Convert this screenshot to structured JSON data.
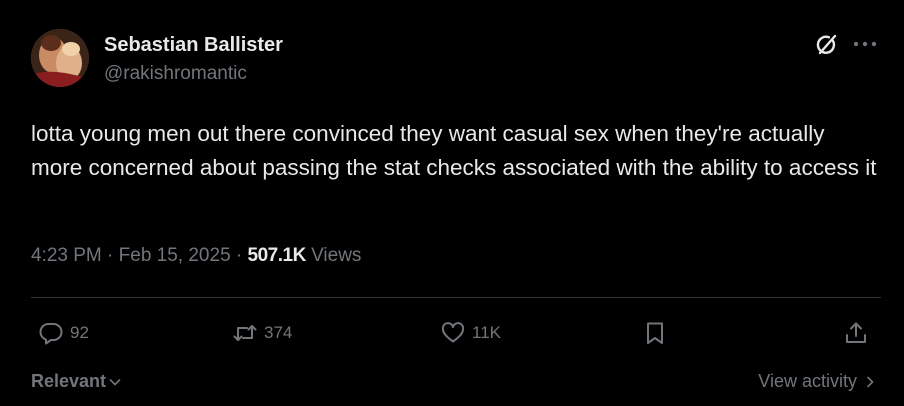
{
  "author": {
    "name": "Sebastian Ballister",
    "handle": "@rakishromantic"
  },
  "tweet": {
    "text": "lotta young men out there convinced they want casual sex when they're actually more concerned about passing the stat checks associated with the ability to access it",
    "time": "4:23 PM",
    "date": "Feb 15, 2025",
    "views_count": "507.1K",
    "views_label": "Views"
  },
  "actions": {
    "replies": "92",
    "reposts": "374",
    "likes": "11K"
  },
  "footer": {
    "sort_label": "Relevant",
    "view_activity_label": "View activity"
  },
  "icons": {
    "grok": "grok-icon",
    "more": "more-icon",
    "reply": "reply-icon",
    "repost": "repost-icon",
    "like": "heart-icon",
    "bookmark": "bookmark-icon",
    "share": "share-icon"
  },
  "colors": {
    "background": "#000000",
    "text": "#e7e9ea",
    "muted": "#71767b",
    "divider": "#2f3336"
  }
}
